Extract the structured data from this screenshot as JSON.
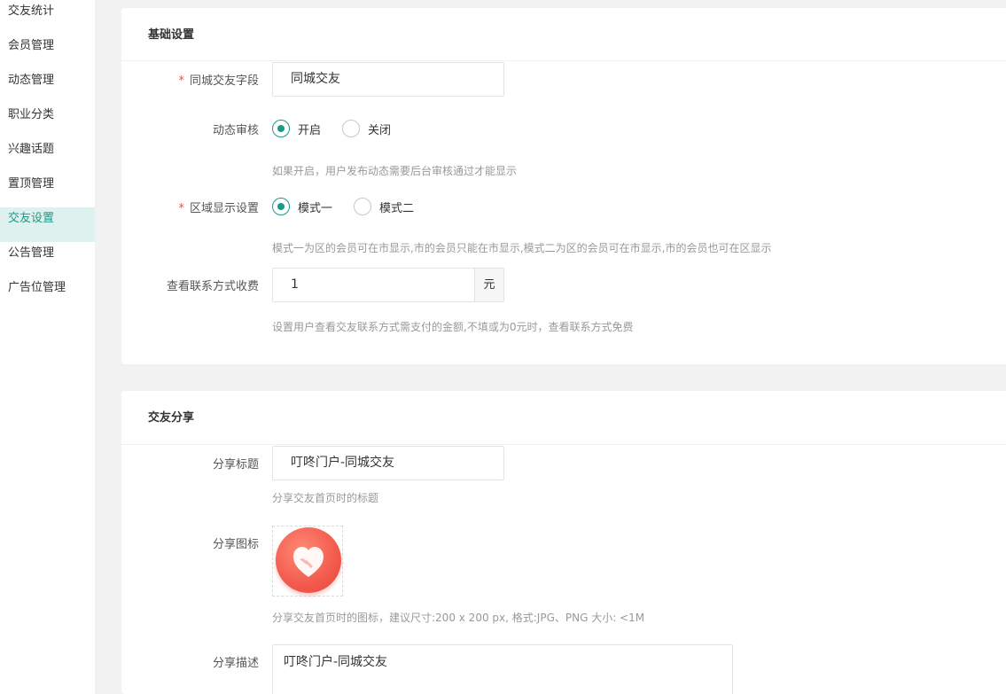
{
  "sidebar": {
    "items": [
      {
        "label": "交友统计",
        "active": false
      },
      {
        "label": "会员管理",
        "active": false
      },
      {
        "label": "动态管理",
        "active": false
      },
      {
        "label": "职业分类",
        "active": false
      },
      {
        "label": "兴趣话题",
        "active": false
      },
      {
        "label": "置顶管理",
        "active": false
      },
      {
        "label": "交友设置",
        "active": true
      },
      {
        "label": "公告管理",
        "active": false
      },
      {
        "label": "广告位管理",
        "active": false
      }
    ]
  },
  "basic": {
    "title": "基础设置",
    "field_name": {
      "required": "*",
      "label": "同城交友字段",
      "value": "同城交友"
    },
    "review": {
      "label": "动态审核",
      "options": [
        "开启",
        "关闭"
      ],
      "selected": 0,
      "hint": "如果开启，用户发布动态需要后台审核通过才能显示"
    },
    "region": {
      "required": "*",
      "label": "区域显示设置",
      "options": [
        "模式一",
        "模式二"
      ],
      "selected": 0,
      "hint": "模式一为区的会员可在市显示,市的会员只能在市显示,模式二为区的会员可在市显示,市的会员也可在区显示"
    },
    "fee": {
      "label": "查看联系方式收费",
      "value": "1",
      "unit": "元",
      "hint": "设置用户查看交友联系方式需支付的金额,不填或为0元时，查看联系方式免费"
    }
  },
  "share": {
    "title": "交友分享",
    "share_title": {
      "label": "分享标题",
      "value": "叮咚门户-同城交友",
      "hint": "分享交友首页时的标题"
    },
    "share_icon": {
      "label": "分享图标",
      "icon": "heart-handshake-icon",
      "hint": "分享交友首页时的图标，建议尺寸:200 x 200 px, 格式:JPG、PNG 大小: <1M"
    },
    "share_desc": {
      "label": "分享描述",
      "value": "叮咚门户-同城交友"
    }
  },
  "colors": {
    "accent": "#1a9a86",
    "required": "#e8524a",
    "active_bg": "#dff1ee"
  }
}
